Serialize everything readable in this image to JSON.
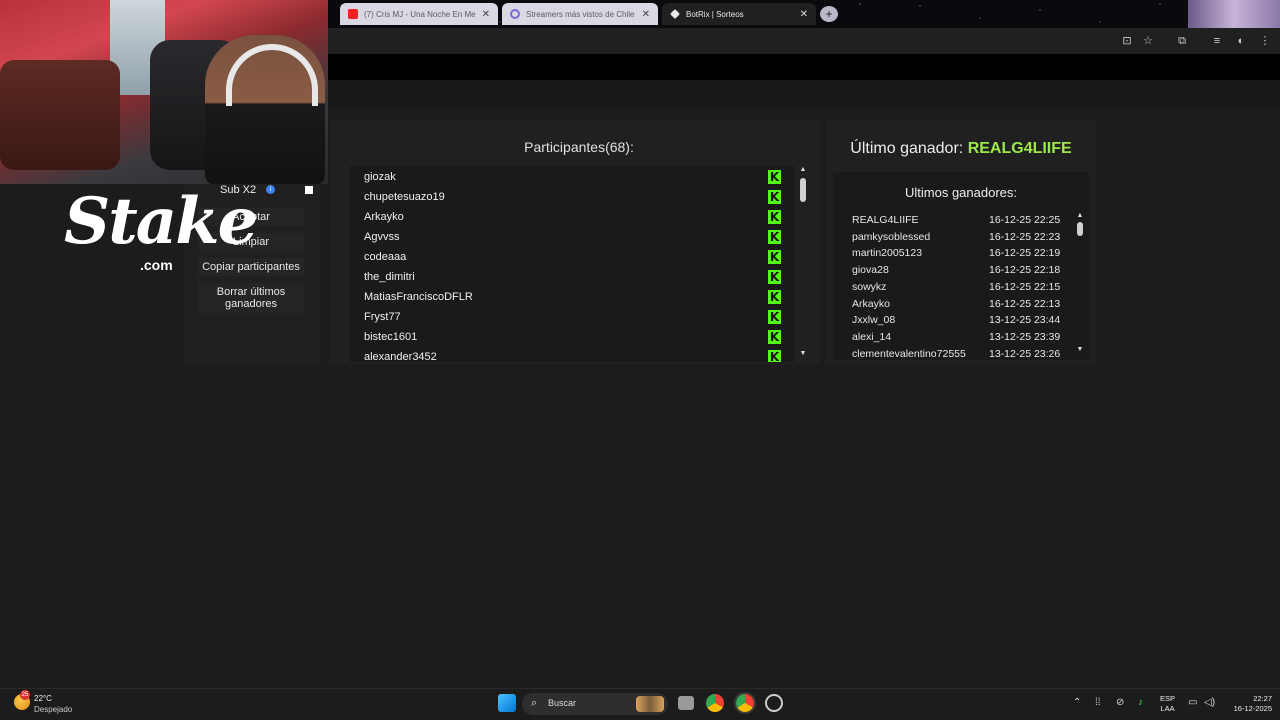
{
  "browser": {
    "tabs": [
      {
        "title": "(7) Cris MJ - Una Noche En Me",
        "favicon": "youtube-icon",
        "active": false
      },
      {
        "title": "Streamers más vistos de Chile",
        "favicon": "loading-icon",
        "active": false
      },
      {
        "title": "BotRix | Sorteos",
        "favicon": "botrix-icon",
        "active": true
      }
    ],
    "new_tab": "+"
  },
  "options": {
    "sub_label": "Sub X2",
    "info_glyph": "i",
    "buttons": {
      "accept": "Aceptar",
      "clear": "Limpiar",
      "copy": "Copiar participantes",
      "delete_winners": "Borrar últimos ganadores"
    }
  },
  "participants": {
    "heading": "Participantes(68):",
    "platform_icon": "kick-icon",
    "items": [
      "giozak",
      "chupetesuazo19",
      "Arkayko",
      "Agvvss",
      "codeaaa",
      "the_dimitri",
      "MatiasFranciscoDFLR",
      "Fryst77",
      "bistec1601",
      "alexander3452"
    ]
  },
  "winners": {
    "last_label": "Último ganador:",
    "last_name": "REALG4LIIFE",
    "heading": "Ultimos ganadores:",
    "items": [
      {
        "name": "REALG4LIIFE",
        "date": "16-12-25 22:25"
      },
      {
        "name": "pamkysoblessed",
        "date": "16-12-25 22:23"
      },
      {
        "name": "martin2005123",
        "date": "16-12-25 22:19"
      },
      {
        "name": "giova28",
        "date": "16-12-25 22:18"
      },
      {
        "name": "sowykz",
        "date": "16-12-25 22:15"
      },
      {
        "name": "Arkayko",
        "date": "16-12-25 22:13"
      },
      {
        "name": "Jxxlw_08",
        "date": "13-12-25 23:44"
      },
      {
        "name": "alexi_14",
        "date": "13-12-25 23:39"
      },
      {
        "name": "clementevalentino72555",
        "date": "13-12-25 23:26"
      }
    ]
  },
  "overlay": {
    "brand": "Stake",
    "brand_suffix": ".com"
  },
  "taskbar": {
    "temperature": "22°C",
    "weather": "Despejado",
    "weather_badge": "25",
    "search_placeholder": "Buscar",
    "lang_top": "ESP",
    "lang_bottom": "LAA",
    "time": "22:27",
    "date": "16-12-2025"
  },
  "colors": {
    "accent_green": "#9de84b",
    "kick_green": "#53fc18",
    "panel_bg": "#202020"
  }
}
